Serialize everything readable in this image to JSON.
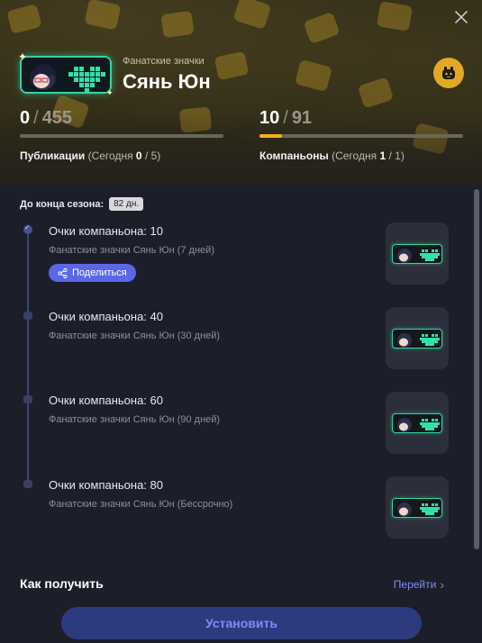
{
  "header": {
    "subtitle": "Фанатские значки",
    "title": "Сянь Юн",
    "close_icon": "close-icon",
    "robot_icon": "robot-icon"
  },
  "stats": {
    "posts": {
      "current": "0",
      "total": "455",
      "label": "Публикации",
      "today_prefix": "(Сегодня",
      "today_value": "0",
      "today_total": "5)",
      "progress": 0.0
    },
    "companions": {
      "current": "10",
      "total": "91",
      "label": "Компаньоны",
      "today_prefix": "(Сегодня",
      "today_value": "1",
      "today_total": "1)",
      "progress": 0.11
    }
  },
  "season": {
    "label": "До конца сезона:",
    "days": "82 дн."
  },
  "rewards": [
    {
      "title": "Очки компаньона: 10",
      "desc": "Фанатские значки Сянь Юн (7 дней)",
      "done": true,
      "share_label": "Поделиться"
    },
    {
      "title": "Очки компаньона: 40",
      "desc": "Фанатские значки Сянь Юн (30 дней)",
      "done": false
    },
    {
      "title": "Очки компаньона: 60",
      "desc": "Фанатские значки Сянь Юн (90 дней)",
      "done": false
    },
    {
      "title": "Очки компаньона: 80",
      "desc": "Фанатские значки Сянь Юн (Бессрочно)",
      "done": false
    }
  ],
  "footer": {
    "how_label": "Как получить",
    "goto_label": "Перейти",
    "install_label": "Установить"
  },
  "colors": {
    "accent_gold": "#f1b21e",
    "accent_blue": "#5a68e8",
    "badge_teal": "#2fd6a0"
  }
}
